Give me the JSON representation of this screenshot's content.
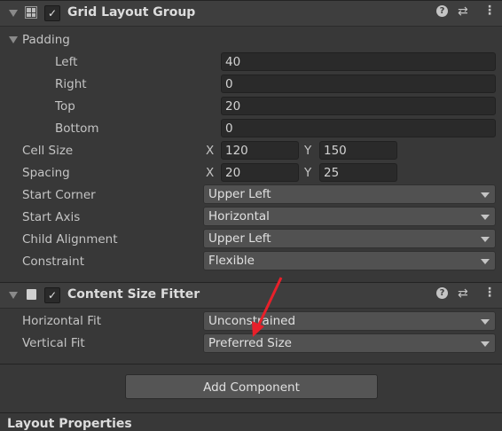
{
  "grid_layout_group": {
    "title": "Grid Layout Group",
    "enabled": true,
    "padding": {
      "label": "Padding",
      "left_label": "Left",
      "left": "40",
      "right_label": "Right",
      "right": "0",
      "top_label": "Top",
      "top": "20",
      "bottom_label": "Bottom",
      "bottom": "0"
    },
    "cell_size": {
      "label": "Cell Size",
      "x_label": "X",
      "x": "120",
      "y_label": "Y",
      "y": "150"
    },
    "spacing": {
      "label": "Spacing",
      "x_label": "X",
      "x": "20",
      "y_label": "Y",
      "y": "25"
    },
    "start_corner": {
      "label": "Start Corner",
      "value": "Upper Left"
    },
    "start_axis": {
      "label": "Start Axis",
      "value": "Horizontal"
    },
    "child_alignment": {
      "label": "Child Alignment",
      "value": "Upper Left"
    },
    "constraint": {
      "label": "Constraint",
      "value": "Flexible"
    }
  },
  "content_size_fitter": {
    "title": "Content Size Fitter",
    "enabled": true,
    "horizontal_fit": {
      "label": "Horizontal Fit",
      "value": "Unconstrained"
    },
    "vertical_fit": {
      "label": "Vertical Fit",
      "value": "Preferred Size"
    }
  },
  "add_component_label": "Add Component",
  "next_section": "Layout Properties",
  "icons": {
    "check": "✓",
    "help": "?",
    "settings": "⇄",
    "more": "⋮"
  },
  "annotation_color": "#e8202a"
}
